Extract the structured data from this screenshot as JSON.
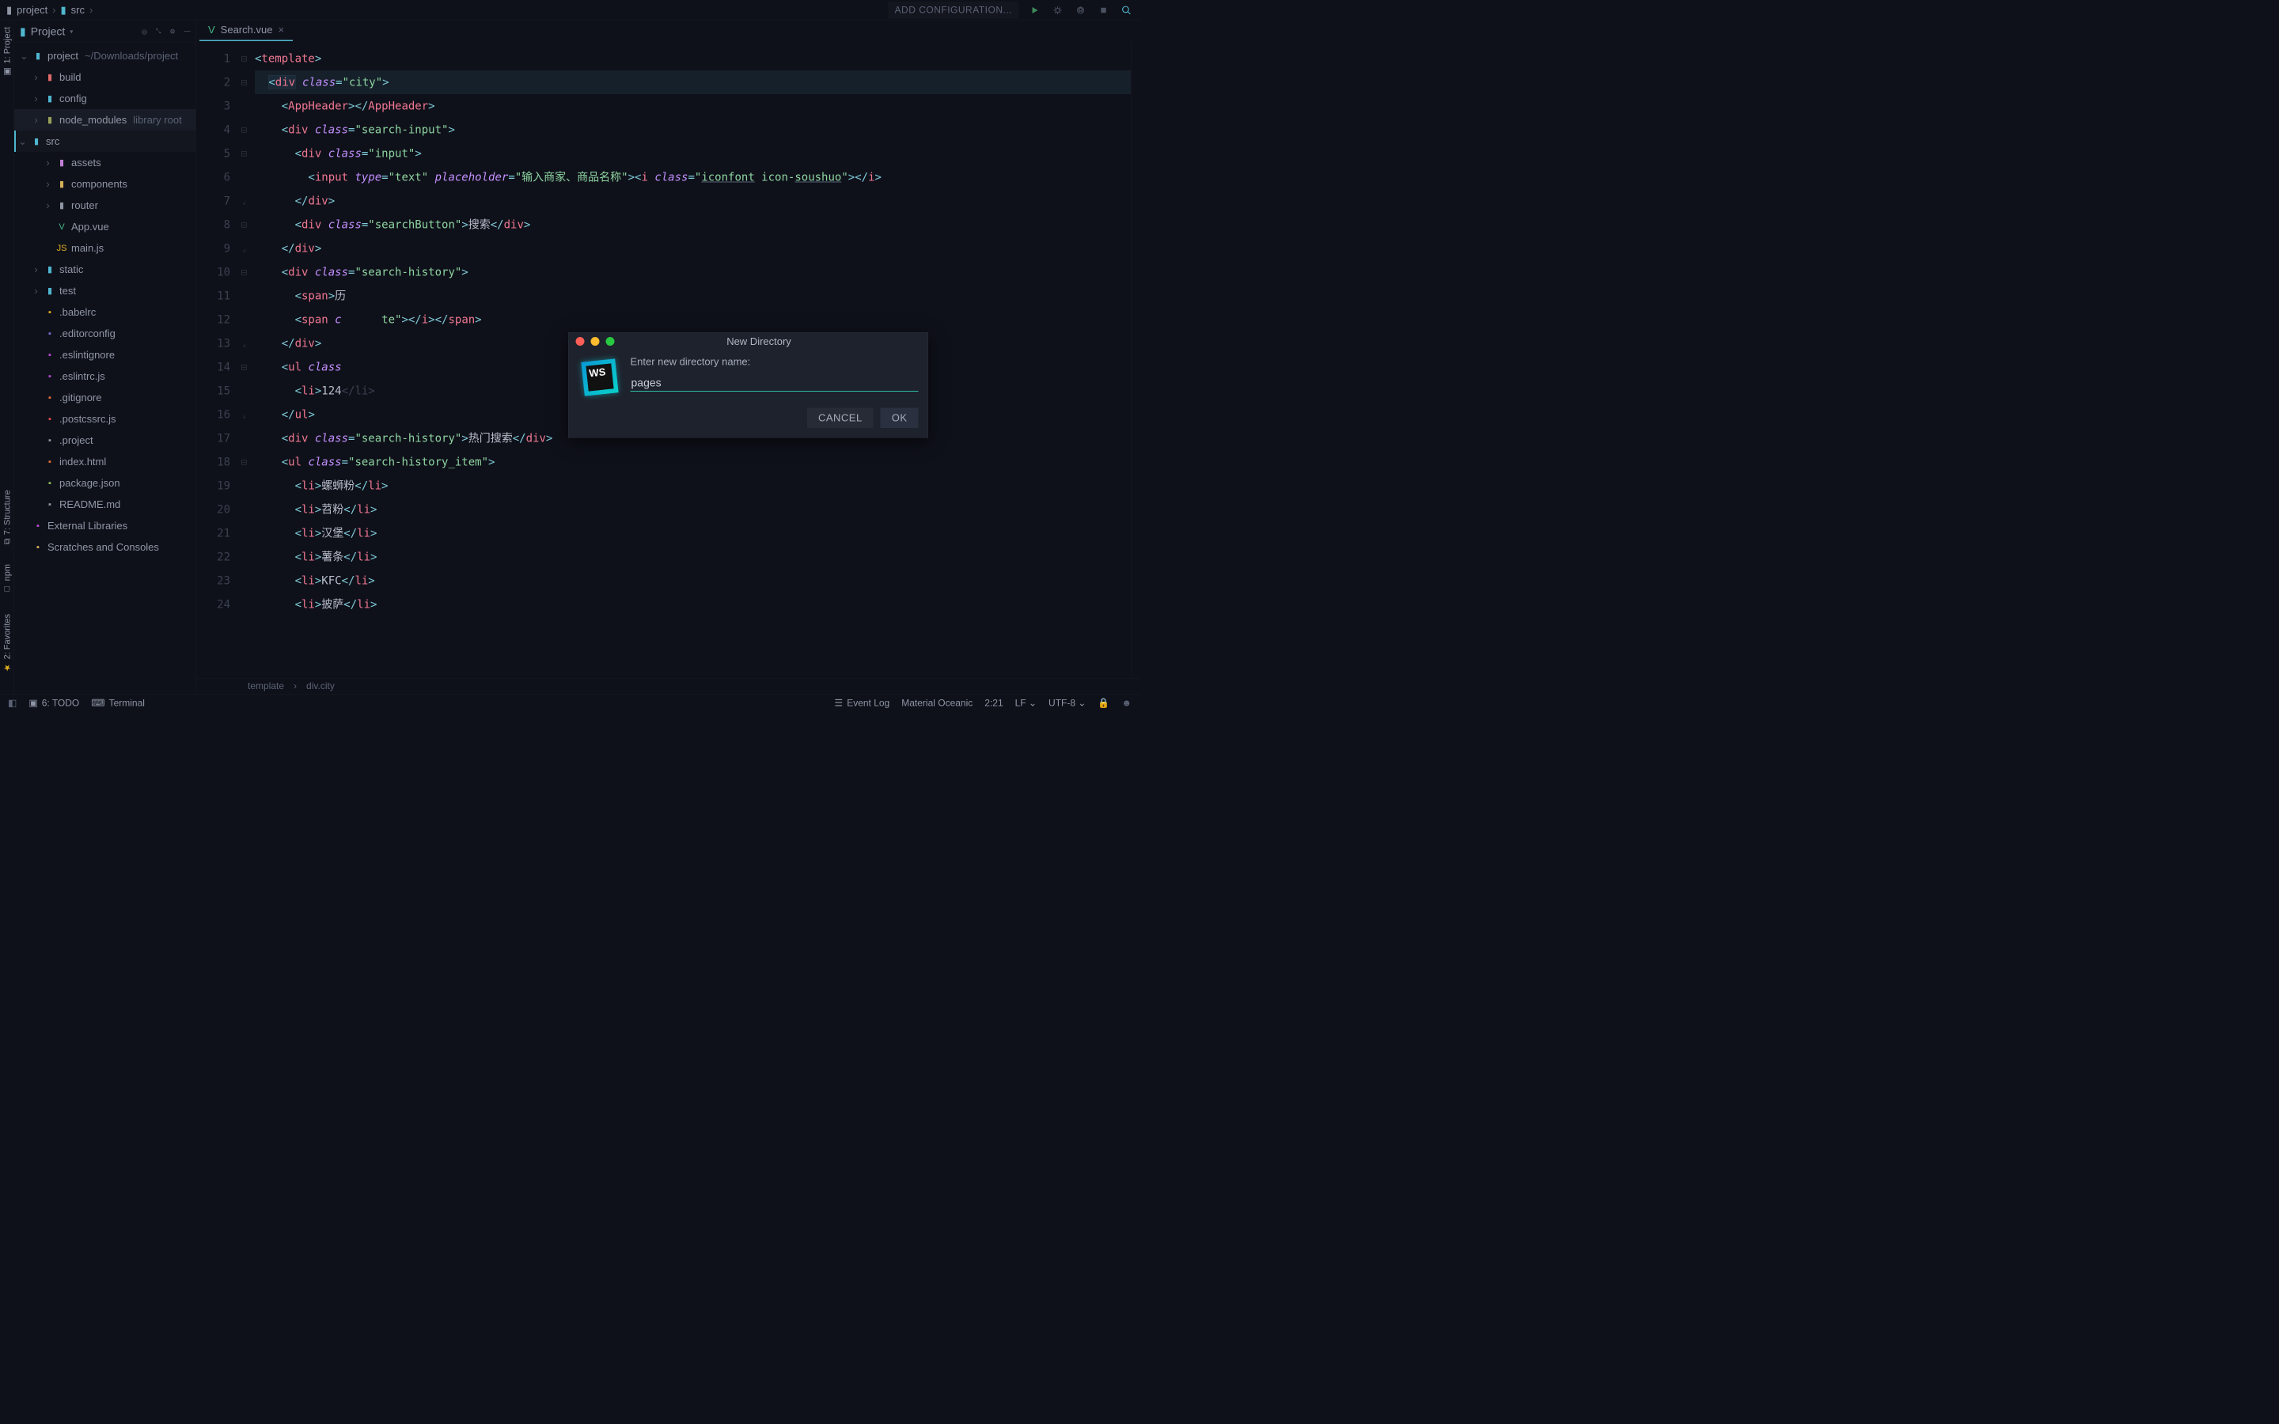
{
  "breadcrumb": {
    "root": "project",
    "child": "src"
  },
  "toolbar": {
    "add_config": "ADD CONFIGURATION..."
  },
  "leftrail": {
    "project": "1: Project",
    "structure": "7: Structure",
    "npm": "npm",
    "favorites": "2: Favorites"
  },
  "projectPanel": {
    "title": "Project"
  },
  "tree": [
    {
      "indent": 0,
      "arrow": "v",
      "iconColor": "#4fb7cf",
      "icon": "folder",
      "label": "project",
      "suffix": "~/Downloads/project"
    },
    {
      "indent": 1,
      "arrow": ">",
      "iconColor": "#e06a6a",
      "icon": "folder",
      "label": "build"
    },
    {
      "indent": 1,
      "arrow": ">",
      "iconColor": "#4fb7cf",
      "icon": "folder",
      "label": "config"
    },
    {
      "indent": 1,
      "arrow": ">",
      "iconColor": "#9aa05a",
      "icon": "folder",
      "label": "node_modules",
      "suffix": "library root",
      "lib": true
    },
    {
      "indent": 1,
      "arrow": "v",
      "iconColor": "#4fb7cf",
      "icon": "folder",
      "label": "src",
      "selected": true
    },
    {
      "indent": 2,
      "arrow": ">",
      "iconColor": "#c07fd4",
      "icon": "folder",
      "label": "assets"
    },
    {
      "indent": 2,
      "arrow": ">",
      "iconColor": "#d4af5a",
      "icon": "folder",
      "label": "components"
    },
    {
      "indent": 2,
      "arrow": ">",
      "iconColor": "#8f96a6",
      "icon": "folder",
      "label": "router"
    },
    {
      "indent": 2,
      "arrow": "",
      "iconColor": "#41b883",
      "icon": "vue",
      "label": "App.vue"
    },
    {
      "indent": 2,
      "arrow": "",
      "iconColor": "#e0b020",
      "icon": "js",
      "label": "main.js"
    },
    {
      "indent": 1,
      "arrow": ">",
      "iconColor": "#4fb7cf",
      "icon": "folder",
      "label": "static"
    },
    {
      "indent": 1,
      "arrow": ">",
      "iconColor": "#4fb7cf",
      "icon": "folder",
      "label": "test"
    },
    {
      "indent": 1,
      "arrow": "",
      "iconColor": "#e0b020",
      "icon": "babel",
      "label": ".babelrc"
    },
    {
      "indent": 1,
      "arrow": "",
      "iconColor": "#7a6fd4",
      "icon": "gear",
      "label": ".editorconfig"
    },
    {
      "indent": 1,
      "arrow": "",
      "iconColor": "#b84ad4",
      "icon": "eslint",
      "label": ".eslintignore"
    },
    {
      "indent": 1,
      "arrow": "",
      "iconColor": "#b84ad4",
      "icon": "eslint",
      "label": ".eslintrc.js"
    },
    {
      "indent": 1,
      "arrow": "",
      "iconColor": "#e06a3a",
      "icon": "git",
      "label": ".gitignore"
    },
    {
      "indent": 1,
      "arrow": "",
      "iconColor": "#e04a4a",
      "icon": "postcss",
      "label": ".postcssrc.js"
    },
    {
      "indent": 1,
      "arrow": "",
      "iconColor": "#8f96a6",
      "icon": "file",
      "label": ".project"
    },
    {
      "indent": 1,
      "arrow": "",
      "iconColor": "#e0703a",
      "icon": "html",
      "label": "index.html"
    },
    {
      "indent": 1,
      "arrow": "",
      "iconColor": "#8fba5a",
      "icon": "npm",
      "label": "package.json"
    },
    {
      "indent": 1,
      "arrow": "",
      "iconColor": "#8f96a6",
      "icon": "md",
      "label": "README.md"
    },
    {
      "indent": 0,
      "arrow": "",
      "iconColor": "#b84ad4",
      "icon": "lib",
      "label": "External Libraries"
    },
    {
      "indent": 0,
      "arrow": "",
      "iconColor": "#d4af5a",
      "icon": "scratch",
      "label": "Scratches and Consoles"
    }
  ],
  "tab": {
    "name": "Search.vue"
  },
  "gutterStart": 1,
  "gutterEnd": 24,
  "code": {
    "l1": {
      "tag": "template"
    },
    "l2": {
      "tag": "div",
      "cls": "city"
    },
    "l3": {
      "tag": "AppHeader"
    },
    "l4": {
      "tag": "div",
      "cls": "search-input"
    },
    "l5": {
      "tag": "div",
      "cls": "input"
    },
    "l6": {
      "tag": "input",
      "type": "text",
      "ph": "输入商家、商品名称",
      "itag": "i",
      "icls": "iconfont icon-soushuo"
    },
    "l7": {
      "close": "div"
    },
    "l8": {
      "tag": "div",
      "cls": "searchButton",
      "text": "搜索"
    },
    "l9": {
      "close": "div"
    },
    "l10": {
      "tag": "div",
      "cls": "search-history"
    },
    "l11": {
      "tag": "span",
      "text_partial": "历"
    },
    "l12": {
      "tag": "span",
      "frag_end": "te\"",
      "tail": "></i></span>"
    },
    "l13": {
      "close": "div"
    },
    "l14": {
      "tag": "ul",
      "attr_partial": "class"
    },
    "l15": {
      "tag": "li",
      "text": "124"
    },
    "l16": {
      "close": "ul"
    },
    "l17": {
      "tag": "div",
      "cls": "search-history",
      "text": "热门搜索"
    },
    "l18": {
      "tag": "ul",
      "cls": "search-history_item"
    },
    "l19": {
      "tag": "li",
      "text": "螺蛳粉"
    },
    "l20": {
      "tag": "li",
      "text": "苕粉"
    },
    "l21": {
      "tag": "li",
      "text": "汉堡"
    },
    "l22": {
      "tag": "li",
      "text": "薯条"
    },
    "l23": {
      "tag": "li",
      "text": "KFC"
    },
    "l24": {
      "tag": "li",
      "text": "披萨"
    }
  },
  "editorCrumbs": {
    "a": "template",
    "sep": "›",
    "b": "div.city"
  },
  "dialog": {
    "title": "New Directory",
    "label": "Enter new directory name:",
    "value": "pages",
    "cancel": "CANCEL",
    "ok": "OK",
    "logo": "WS"
  },
  "bottombar": {
    "todo": "6: TODO",
    "terminal": "Terminal",
    "eventlog": "Event Log",
    "theme": "Material Oceanic",
    "pos": "2:21",
    "lf": "LF",
    "enc": "UTF-8"
  }
}
